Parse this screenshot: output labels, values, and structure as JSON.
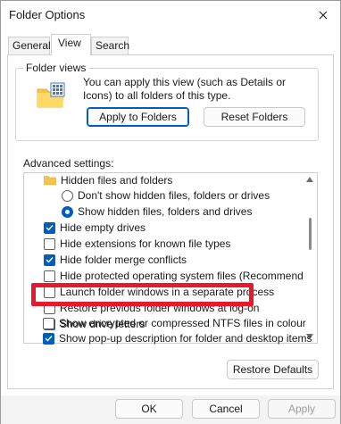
{
  "window": {
    "title": "Folder Options"
  },
  "tabs": [
    {
      "label": "General"
    },
    {
      "label": "View"
    },
    {
      "label": "Search"
    }
  ],
  "folder_views": {
    "group_label": "Folder views",
    "description": "You can apply this view (such as Details or Icons) to all folders of this type.",
    "apply_button": "Apply to Folders",
    "reset_button": "Reset Folders"
  },
  "advanced": {
    "label": "Advanced settings:",
    "items": [
      {
        "type": "folder",
        "label": "Hidden files and folders"
      },
      {
        "type": "radio",
        "label": "Don't show hidden files, folders or drives",
        "selected": false
      },
      {
        "type": "radio",
        "label": "Show hidden files, folders and drives",
        "selected": true
      },
      {
        "type": "checkbox",
        "label": "Hide empty drives",
        "checked": true
      },
      {
        "type": "checkbox",
        "label": "Hide extensions for known file types",
        "checked": false
      },
      {
        "type": "checkbox",
        "label": "Hide folder merge conflicts",
        "checked": true
      },
      {
        "type": "checkbox",
        "label": "Hide protected operating system files (Recommended)",
        "checked": false
      },
      {
        "type": "checkbox",
        "label": "Launch folder windows in a separate process",
        "checked": false
      },
      {
        "type": "checkbox",
        "label": "Restore previous folder windows at log-on",
        "checked": false
      },
      {
        "type": "checkbox",
        "label": "Show drive letters",
        "checked": true
      },
      {
        "type": "checkbox",
        "label": "Show encrypted or compressed NTFS files in colour",
        "checked": false
      },
      {
        "type": "checkbox",
        "label": "Show pop-up description for folder and desktop items",
        "checked": true
      }
    ]
  },
  "restore_defaults_button": "Restore Defaults",
  "footer": {
    "ok": "OK",
    "cancel": "Cancel",
    "apply": "Apply"
  },
  "colors": {
    "accent": "#005fb8",
    "highlight": "#e8192c",
    "folder_yellow": "#f5c44e"
  }
}
